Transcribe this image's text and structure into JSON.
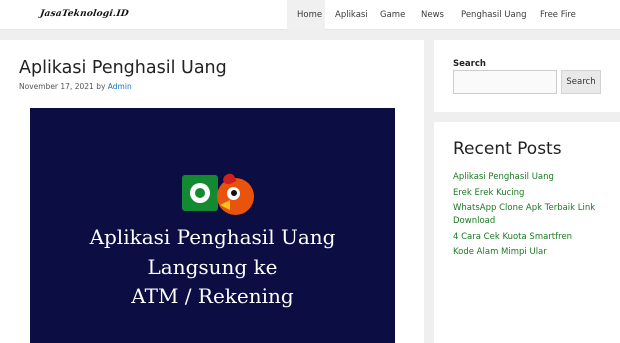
{
  "header": {
    "logo_text": "JasaTeknologi.ID",
    "nav": [
      {
        "label": "Home",
        "active": true
      },
      {
        "label": "Aplikasi",
        "active": false
      },
      {
        "label": "Game",
        "active": false
      },
      {
        "label": "News",
        "active": false
      },
      {
        "label": "Penghasil Uang",
        "active": false
      },
      {
        "label": "Free Fire",
        "active": false
      }
    ]
  },
  "post": {
    "title": "Aplikasi Penghasil Uang",
    "date": "November 17, 2021",
    "by_label": "by",
    "author": "Admin",
    "featured_image": {
      "background_color": "#0b0d43",
      "line1": "Aplikasi Penghasil Uang",
      "line2": "Langsung ke",
      "line3": "ATM / Rekening"
    }
  },
  "sidebar": {
    "search": {
      "label": "Search",
      "input_value": "",
      "button_label": "Search"
    },
    "recent": {
      "title": "Recent Posts",
      "items": [
        "Aplikasi Penghasil Uang",
        "Erek Erek Kucing",
        "WhatsApp Clone Apk Terbaik Link Download",
        "4 Cara Cek Kuota Smartfren",
        "Kode Alam Mimpi Ular"
      ],
      "link_color": "#1a7a22"
    }
  }
}
